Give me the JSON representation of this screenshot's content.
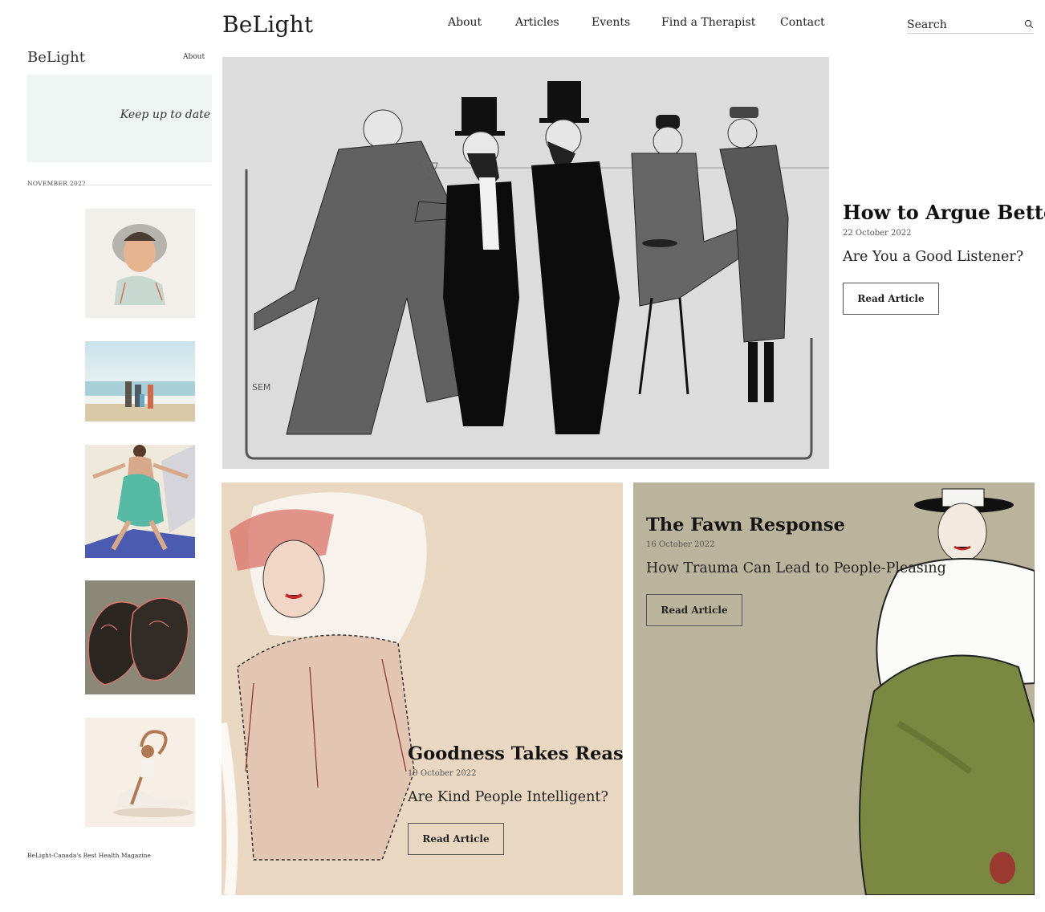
{
  "header": {
    "brand": "BeLight",
    "nav": [
      {
        "label": "About"
      },
      {
        "label": "Articles"
      },
      {
        "label": "Events"
      },
      {
        "label": "Find a Therapist"
      },
      {
        "label": "Contact"
      }
    ],
    "search_placeholder": "Search"
  },
  "sidebar": {
    "brand": "BeLight",
    "about_link": "About",
    "newsletter_text": "Keep up to date",
    "month": "NOVEMBER 2022",
    "footer": "BeLight-Canada's Best Health Magazine"
  },
  "featured": {
    "title": "How to Argue Better",
    "date": "22 October 2022",
    "subtitle": "Are You a Good Listener?",
    "button": "Read Article",
    "signature": "SEM"
  },
  "cards": [
    {
      "title": "Goodness Takes Reason",
      "date": "19 October 2022",
      "subtitle": "Are Kind People Intelligent?",
      "button": "Read Article"
    },
    {
      "title": "The Fawn Response",
      "date": "16 October 2022",
      "subtitle": "How Trauma Can Lead to People-Pleasing",
      "button": "Read Article"
    }
  ],
  "colors": {
    "newsletter_bg": "#eef5f3",
    "card_goodness_bg": "#e9d7c2",
    "card_fawn_bg": "#bbb49c",
    "hero_bg": "#dcdcdc"
  },
  "icons": [
    "search-icon"
  ]
}
